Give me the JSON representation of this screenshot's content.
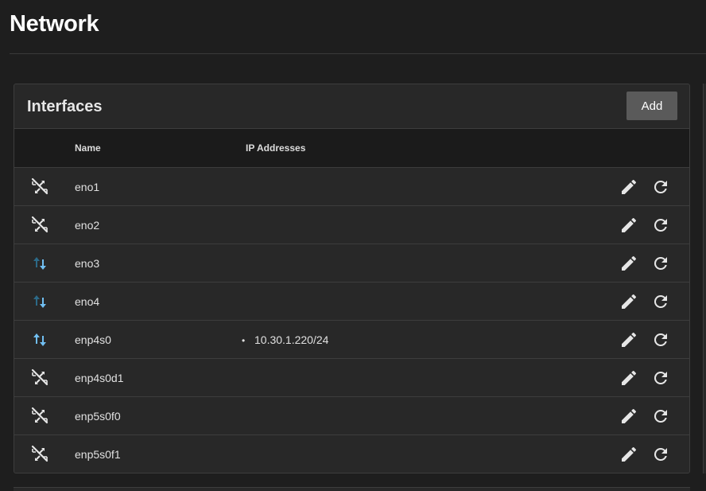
{
  "page": {
    "title": "Network"
  },
  "interfaces_card": {
    "title": "Interfaces",
    "add_label": "Add",
    "columns": {
      "name": "Name",
      "ip": "IP Addresses"
    },
    "rows": [
      {
        "name": "eno1",
        "status": "disconnected",
        "ips": []
      },
      {
        "name": "eno2",
        "status": "disconnected",
        "ips": []
      },
      {
        "name": "eno3",
        "status": "link-partial",
        "ips": []
      },
      {
        "name": "eno4",
        "status": "link-partial",
        "ips": []
      },
      {
        "name": "enp4s0",
        "status": "link-up",
        "ips": [
          "10.30.1.220/24"
        ]
      },
      {
        "name": "enp4s0d1",
        "status": "disconnected",
        "ips": []
      },
      {
        "name": "enp5s0f0",
        "status": "disconnected",
        "ips": []
      },
      {
        "name": "enp5s0f1",
        "status": "disconnected",
        "ips": []
      }
    ]
  },
  "colors": {
    "background": "#1e1e1e",
    "card": "#282828",
    "link_up_arrow": "#71bff2",
    "link_partial_up_arrow": "#2c6a88",
    "icon": "#e6e6e6"
  },
  "icons": {
    "disconnected": "lan-disconnect-icon",
    "link_up": "swap-vertical-arrows-icon",
    "edit": "pencil-icon",
    "reset": "refresh-icon"
  }
}
